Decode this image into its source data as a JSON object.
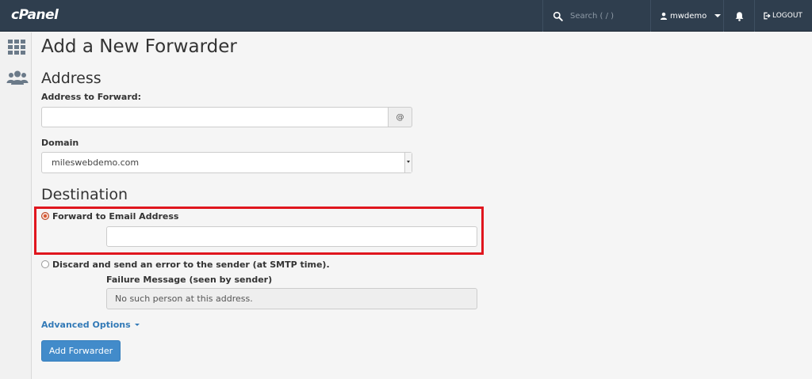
{
  "header": {
    "logo": "cPanel",
    "search_placeholder": "Search ( / )",
    "username": "mwdemo",
    "logout_label": "LOGOUT"
  },
  "page": {
    "title": "Add a New Forwarder"
  },
  "address_section": {
    "heading": "Address",
    "address_label": "Address to Forward:",
    "address_value": "",
    "at_symbol": "@",
    "domain_label": "Domain",
    "domain_selected": "mileswebdemo.com"
  },
  "destination_section": {
    "heading": "Destination",
    "forward_option_label": "Forward to Email Address",
    "forward_option_selected": true,
    "forward_email_value": "",
    "discard_option_label": "Discard and send an error to the sender (at SMTP time).",
    "failure_label": "Failure Message (seen by sender)",
    "failure_placeholder": "No such person at this address."
  },
  "advanced_options_label": "Advanced Options",
  "submit_label": "Add Forwarder",
  "colors": {
    "topbar": "#2f3e4e",
    "primary": "#428bca",
    "link": "#337ab7",
    "highlight": "#e0161e"
  },
  "icons": {
    "rail": [
      "grid-icon",
      "users-icon"
    ],
    "header": [
      "search-icon",
      "user-icon",
      "bell-icon",
      "logout-icon"
    ]
  }
}
